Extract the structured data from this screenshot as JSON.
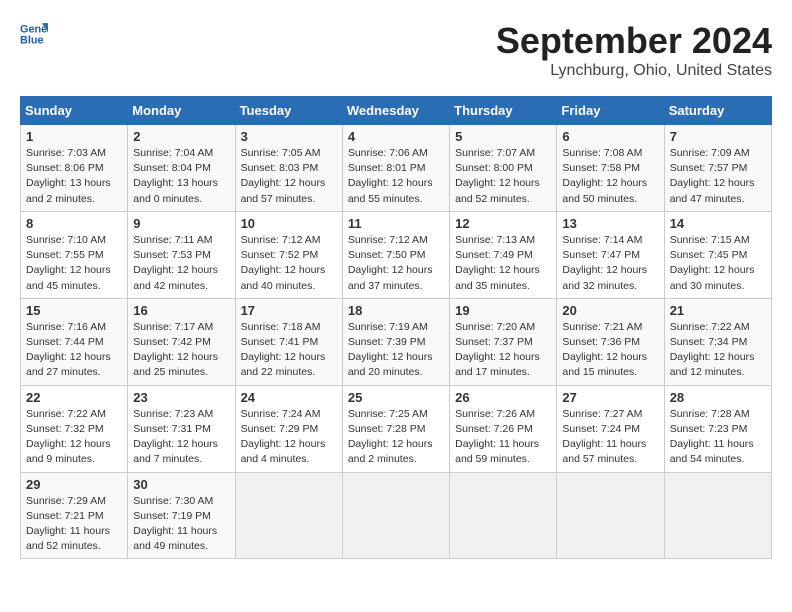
{
  "header": {
    "logo_line1": "General",
    "logo_line2": "Blue",
    "month": "September 2024",
    "location": "Lynchburg, Ohio, United States"
  },
  "days_of_week": [
    "Sunday",
    "Monday",
    "Tuesday",
    "Wednesday",
    "Thursday",
    "Friday",
    "Saturday"
  ],
  "weeks": [
    [
      {
        "day": "1",
        "info": "Sunrise: 7:03 AM\nSunset: 8:06 PM\nDaylight: 13 hours\nand 2 minutes."
      },
      {
        "day": "2",
        "info": "Sunrise: 7:04 AM\nSunset: 8:04 PM\nDaylight: 13 hours\nand 0 minutes."
      },
      {
        "day": "3",
        "info": "Sunrise: 7:05 AM\nSunset: 8:03 PM\nDaylight: 12 hours\nand 57 minutes."
      },
      {
        "day": "4",
        "info": "Sunrise: 7:06 AM\nSunset: 8:01 PM\nDaylight: 12 hours\nand 55 minutes."
      },
      {
        "day": "5",
        "info": "Sunrise: 7:07 AM\nSunset: 8:00 PM\nDaylight: 12 hours\nand 52 minutes."
      },
      {
        "day": "6",
        "info": "Sunrise: 7:08 AM\nSunset: 7:58 PM\nDaylight: 12 hours\nand 50 minutes."
      },
      {
        "day": "7",
        "info": "Sunrise: 7:09 AM\nSunset: 7:57 PM\nDaylight: 12 hours\nand 47 minutes."
      }
    ],
    [
      {
        "day": "8",
        "info": "Sunrise: 7:10 AM\nSunset: 7:55 PM\nDaylight: 12 hours\nand 45 minutes."
      },
      {
        "day": "9",
        "info": "Sunrise: 7:11 AM\nSunset: 7:53 PM\nDaylight: 12 hours\nand 42 minutes."
      },
      {
        "day": "10",
        "info": "Sunrise: 7:12 AM\nSunset: 7:52 PM\nDaylight: 12 hours\nand 40 minutes."
      },
      {
        "day": "11",
        "info": "Sunrise: 7:12 AM\nSunset: 7:50 PM\nDaylight: 12 hours\nand 37 minutes."
      },
      {
        "day": "12",
        "info": "Sunrise: 7:13 AM\nSunset: 7:49 PM\nDaylight: 12 hours\nand 35 minutes."
      },
      {
        "day": "13",
        "info": "Sunrise: 7:14 AM\nSunset: 7:47 PM\nDaylight: 12 hours\nand 32 minutes."
      },
      {
        "day": "14",
        "info": "Sunrise: 7:15 AM\nSunset: 7:45 PM\nDaylight: 12 hours\nand 30 minutes."
      }
    ],
    [
      {
        "day": "15",
        "info": "Sunrise: 7:16 AM\nSunset: 7:44 PM\nDaylight: 12 hours\nand 27 minutes."
      },
      {
        "day": "16",
        "info": "Sunrise: 7:17 AM\nSunset: 7:42 PM\nDaylight: 12 hours\nand 25 minutes."
      },
      {
        "day": "17",
        "info": "Sunrise: 7:18 AM\nSunset: 7:41 PM\nDaylight: 12 hours\nand 22 minutes."
      },
      {
        "day": "18",
        "info": "Sunrise: 7:19 AM\nSunset: 7:39 PM\nDaylight: 12 hours\nand 20 minutes."
      },
      {
        "day": "19",
        "info": "Sunrise: 7:20 AM\nSunset: 7:37 PM\nDaylight: 12 hours\nand 17 minutes."
      },
      {
        "day": "20",
        "info": "Sunrise: 7:21 AM\nSunset: 7:36 PM\nDaylight: 12 hours\nand 15 minutes."
      },
      {
        "day": "21",
        "info": "Sunrise: 7:22 AM\nSunset: 7:34 PM\nDaylight: 12 hours\nand 12 minutes."
      }
    ],
    [
      {
        "day": "22",
        "info": "Sunrise: 7:22 AM\nSunset: 7:32 PM\nDaylight: 12 hours\nand 9 minutes."
      },
      {
        "day": "23",
        "info": "Sunrise: 7:23 AM\nSunset: 7:31 PM\nDaylight: 12 hours\nand 7 minutes."
      },
      {
        "day": "24",
        "info": "Sunrise: 7:24 AM\nSunset: 7:29 PM\nDaylight: 12 hours\nand 4 minutes."
      },
      {
        "day": "25",
        "info": "Sunrise: 7:25 AM\nSunset: 7:28 PM\nDaylight: 12 hours\nand 2 minutes."
      },
      {
        "day": "26",
        "info": "Sunrise: 7:26 AM\nSunset: 7:26 PM\nDaylight: 11 hours\nand 59 minutes."
      },
      {
        "day": "27",
        "info": "Sunrise: 7:27 AM\nSunset: 7:24 PM\nDaylight: 11 hours\nand 57 minutes."
      },
      {
        "day": "28",
        "info": "Sunrise: 7:28 AM\nSunset: 7:23 PM\nDaylight: 11 hours\nand 54 minutes."
      }
    ],
    [
      {
        "day": "29",
        "info": "Sunrise: 7:29 AM\nSunset: 7:21 PM\nDaylight: 11 hours\nand 52 minutes."
      },
      {
        "day": "30",
        "info": "Sunrise: 7:30 AM\nSunset: 7:19 PM\nDaylight: 11 hours\nand 49 minutes."
      },
      {
        "day": "",
        "info": ""
      },
      {
        "day": "",
        "info": ""
      },
      {
        "day": "",
        "info": ""
      },
      {
        "day": "",
        "info": ""
      },
      {
        "day": "",
        "info": ""
      }
    ]
  ]
}
